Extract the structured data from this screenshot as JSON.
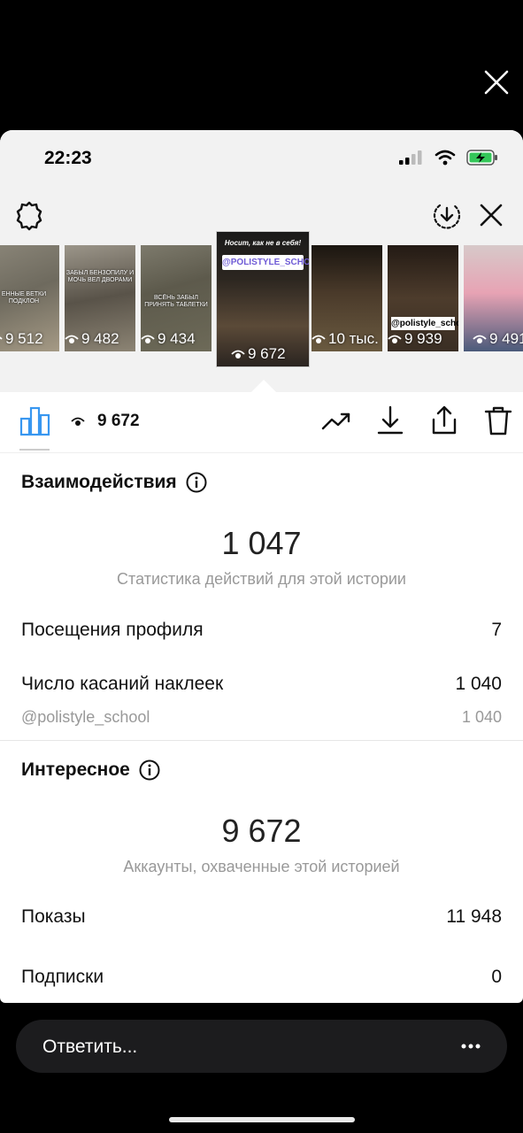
{
  "status_bar": {
    "time": "22:23"
  },
  "story_strip": [
    {
      "caption": "ЕННЫЕ ВЕТКИ ПОДКЛОН",
      "views": "9 512"
    },
    {
      "caption": "ЗАБЫЛ БЕНЗОПИЛУ И МОЧЬ ВЕЛ ДВОРАМИ",
      "views": "9 482"
    },
    {
      "caption": "ВСЁНЬ ЗАБЫЛ ПРИНЯТЬ ТАБЛЕТКИ",
      "views": "9 434"
    },
    {
      "title": "Носит, как не в себя!",
      "tag": "@POLISTYLE_SCHOOL",
      "views": "9 672",
      "selected": true
    },
    {
      "views": "10 тыс."
    },
    {
      "tag": "@polistyle_school",
      "views": "9 939"
    },
    {
      "views": "9 491"
    }
  ],
  "action_bar": {
    "views": "9 672"
  },
  "interactions": {
    "title": "Взаимодействия",
    "total": "1 047",
    "subtitle": "Статистика действий для этой истории",
    "rows": [
      {
        "label": "Посещения профиля",
        "value": "7"
      },
      {
        "label": "Число касаний наклеек",
        "value": "1 040"
      },
      {
        "label": "@polistyle_school",
        "value": "1 040"
      }
    ]
  },
  "discovery": {
    "title": "Интересное",
    "total": "9 672",
    "subtitle": "Аккаунты, охваченные этой историей",
    "rows": [
      {
        "label": "Показы",
        "value": "11 948"
      },
      {
        "label": "Подписки",
        "value": "0"
      }
    ]
  },
  "reply": {
    "placeholder": "Ответить..."
  }
}
